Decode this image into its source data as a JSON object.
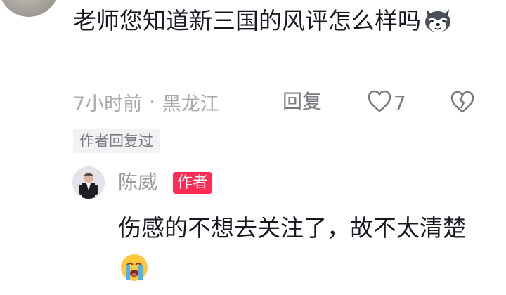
{
  "comment": {
    "text": "老师您知道新三国的风评怎么样吗",
    "emoji": "wolf-emoji",
    "time": "7小时前",
    "separator": "·",
    "location": "黑龙江",
    "reply_label": "回复",
    "like_count": "7",
    "author_replied_tag": "作者回复过"
  },
  "reply": {
    "name": "陈威",
    "badge": "作者",
    "text": "伤感的不想去关注了，故不太清楚",
    "emoji": "crying-emoji"
  },
  "colors": {
    "badge": "#fe2c55",
    "muted_text": "#a8a8ad",
    "primary_text": "#161823"
  }
}
